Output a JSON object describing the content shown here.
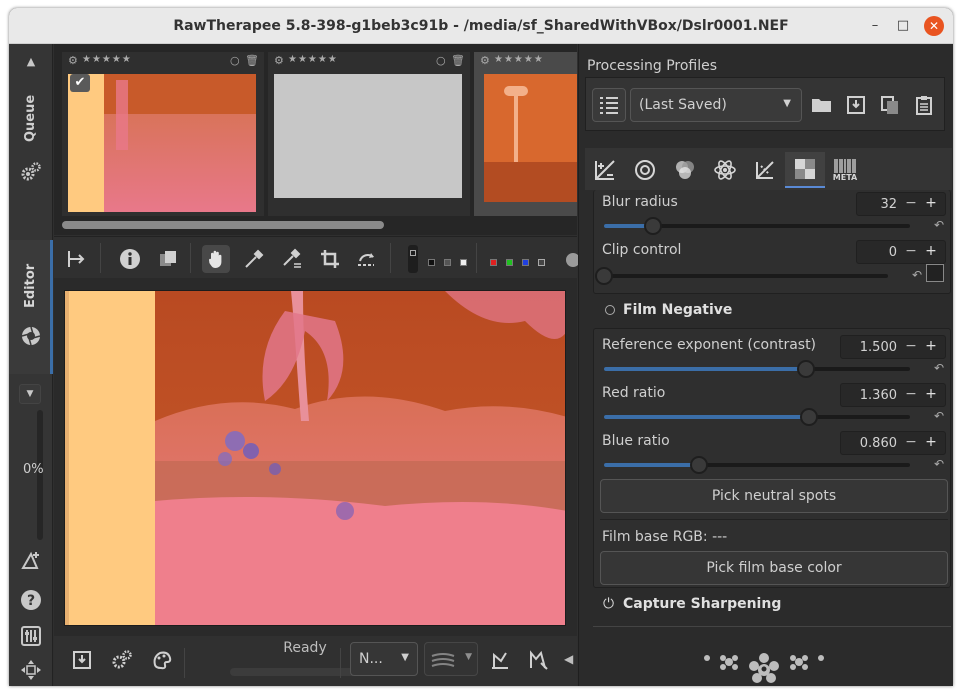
{
  "window": {
    "title": "RawTherapee 5.8-398-g1beb3c91b - /media/sf_SharedWithVBox/Dslr0001.NEF",
    "minimize": "–",
    "maximize": "□",
    "close": "✕"
  },
  "sidebar": {
    "queue_label": "Queue",
    "editor_label": "Editor",
    "zoom_percent": "0%"
  },
  "filmstrip": {
    "thumbnails": [
      {
        "stars": "★★★★★",
        "selected": false,
        "checked": true
      },
      {
        "stars": "★★★★★",
        "selected": false,
        "checked": false
      },
      {
        "stars": "★★★★★",
        "selected": true,
        "checked": false
      }
    ]
  },
  "statusbar": {
    "status": "Ready",
    "profile_combo": "N..."
  },
  "right_panel": {
    "processing_profiles_label": "Processing Profiles",
    "profile_selected": "(Last Saved)",
    "tool_tabs": [
      "exposure",
      "detail",
      "color",
      "advanced",
      "transform",
      "raw",
      "meta"
    ],
    "meta_label": "META",
    "blur_radius": {
      "label": "Blur radius",
      "value": "32",
      "fraction": 0.16
    },
    "clip_control": {
      "label": "Clip control",
      "value": "0",
      "fraction": 0.0
    },
    "film_negative": {
      "title": "Film Negative",
      "reference_exponent": {
        "label": "Reference exponent (contrast)",
        "value": "1.500",
        "fraction": 0.66
      },
      "red_ratio": {
        "label": "Red ratio",
        "value": "1.360",
        "fraction": 0.67
      },
      "blue_ratio": {
        "label": "Blue ratio",
        "value": "0.860",
        "fraction": 0.31
      },
      "pick_neutral": "Pick neutral spots",
      "film_base_rgb": "Film base RGB: ---",
      "pick_film_base": "Pick film base color"
    },
    "capture_sharpening": "Capture Sharpening"
  },
  "colors": {
    "accent": "#3b6ea8",
    "close_button": "#e95420",
    "photo_orange": "#c85a2a",
    "photo_pink": "#e8788a",
    "film_base": "#ffca80"
  }
}
